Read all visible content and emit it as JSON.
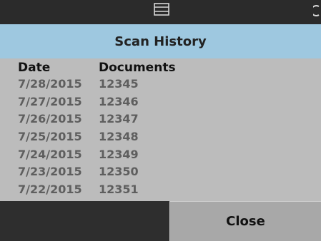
{
  "status_bar": {
    "icons": [
      "scanner-icon",
      "power-icon"
    ]
  },
  "header": {
    "title": "Scan History"
  },
  "table": {
    "columns": [
      "Date",
      "Documents"
    ],
    "rows": [
      {
        "date": "7/28/2015",
        "documents": "12345"
      },
      {
        "date": "7/27/2015",
        "documents": "12346"
      },
      {
        "date": "7/26/2015",
        "documents": "12347"
      },
      {
        "date": "7/25/2015",
        "documents": "12348"
      },
      {
        "date": "7/24/2015",
        "documents": "12349"
      },
      {
        "date": "7/23/2015",
        "documents": "12350"
      },
      {
        "date": "7/22/2015",
        "documents": "12351"
      }
    ]
  },
  "footer": {
    "close_label": "Close"
  },
  "colors": {
    "title_bar": "#9ec8e0",
    "list_bg": "#bcbcbc",
    "button_bg": "#a8a8a8",
    "dark_bg": "#2e2e2e"
  }
}
